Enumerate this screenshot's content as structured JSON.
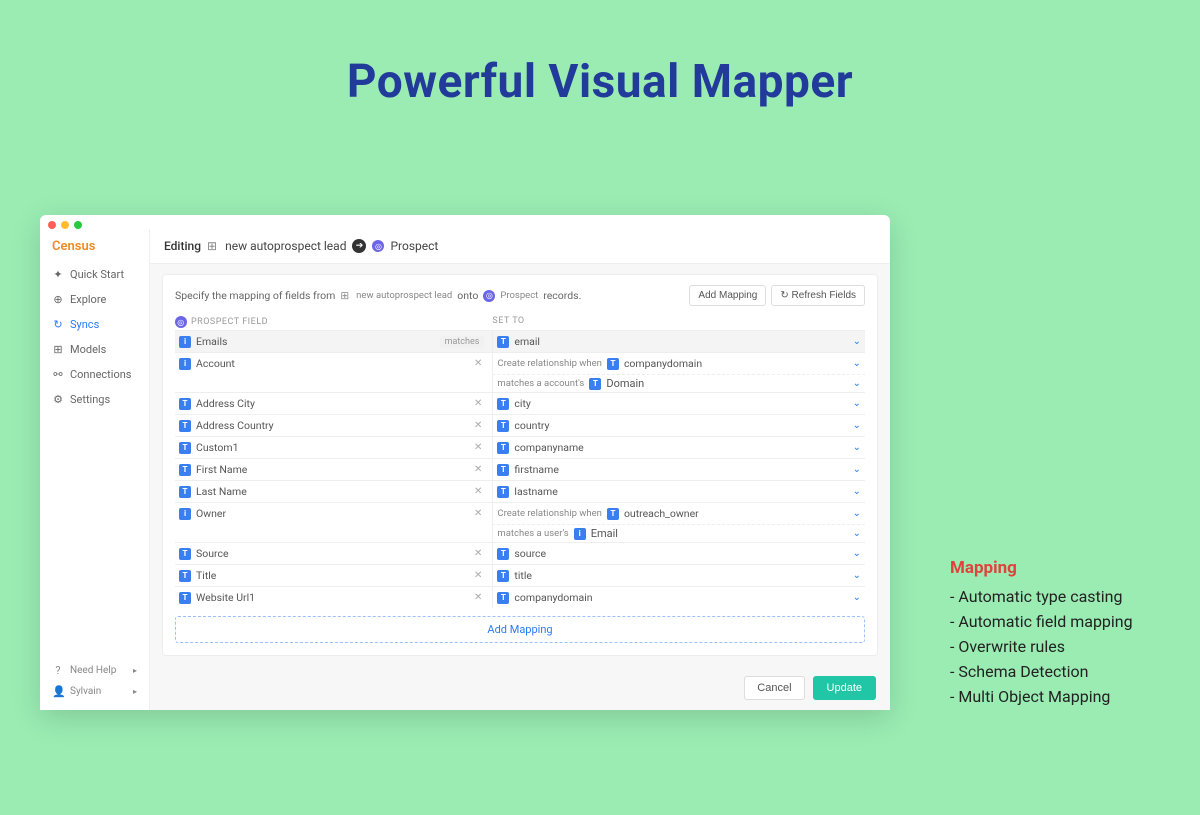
{
  "hero": {
    "title": "Powerful Visual  Mapper"
  },
  "sidebar": {
    "brand": "Census",
    "items": [
      {
        "label": "Quick Start",
        "icon": "✦"
      },
      {
        "label": "Explore",
        "icon": "⊕"
      },
      {
        "label": "Syncs",
        "icon": "↻",
        "active": true
      },
      {
        "label": "Models",
        "icon": "⊞"
      },
      {
        "label": "Connections",
        "icon": "⚯"
      },
      {
        "label": "Settings",
        "icon": "⚙"
      }
    ],
    "help_label": "Need Help",
    "user_label": "Sylvain"
  },
  "editbar": {
    "editing": "Editing",
    "source": "new autoprospect lead",
    "target": "Prospect"
  },
  "panel": {
    "instruction_prefix": "Specify the mapping of fields from",
    "instruction_source": "new autoprospect lead",
    "instruction_mid": "onto",
    "instruction_target": "Prospect",
    "instruction_suffix": "records.",
    "add_mapping_btn": "Add Mapping",
    "refresh_btn": "Refresh Fields",
    "col_left": "PROSPECT FIELD",
    "col_right": "SET TO",
    "add_row": "Add Mapping"
  },
  "rows": [
    {
      "lead_type": "i",
      "lead": "Emails",
      "close": "matches",
      "set_type": "t",
      "set": "email",
      "highlight": true
    },
    {
      "lead_type": "i",
      "lead": "Account",
      "close": "x",
      "rel_prefix": "Create relationship when",
      "set_type": "t",
      "set": "companydomain",
      "sub_prefix": "matches a account's",
      "sub_type": "t",
      "sub": "Domain"
    },
    {
      "lead_type": "t",
      "lead": "Address City",
      "close": "x",
      "set_type": "t",
      "set": "city"
    },
    {
      "lead_type": "t",
      "lead": "Address Country",
      "close": "x",
      "set_type": "t",
      "set": "country"
    },
    {
      "lead_type": "t",
      "lead": "Custom1",
      "close": "x",
      "set_type": "t",
      "set": "companyname"
    },
    {
      "lead_type": "t",
      "lead": "First Name",
      "close": "x",
      "set_type": "t",
      "set": "firstname"
    },
    {
      "lead_type": "t",
      "lead": "Last Name",
      "close": "x",
      "set_type": "t",
      "set": "lastname"
    },
    {
      "lead_type": "i",
      "lead": "Owner",
      "close": "x",
      "rel_prefix": "Create relationship when",
      "set_type": "t",
      "set": "outreach_owner",
      "sub_prefix": "matches a user's",
      "sub_type": "i",
      "sub": "Email"
    },
    {
      "lead_type": "t",
      "lead": "Source",
      "close": "x",
      "set_type": "t",
      "set": "source"
    },
    {
      "lead_type": "t",
      "lead": "Title",
      "close": "x",
      "set_type": "t",
      "set": "title"
    },
    {
      "lead_type": "t",
      "lead": "Website Url1",
      "close": "x",
      "set_type": "t",
      "set": "companydomain"
    }
  ],
  "footer": {
    "cancel": "Cancel",
    "update": "Update"
  },
  "notes": {
    "heading": "Mapping",
    "items": [
      "Automatic type casting",
      "Automatic field mapping",
      "Overwrite rules",
      "Schema Detection",
      "Multi Object Mapping"
    ]
  }
}
